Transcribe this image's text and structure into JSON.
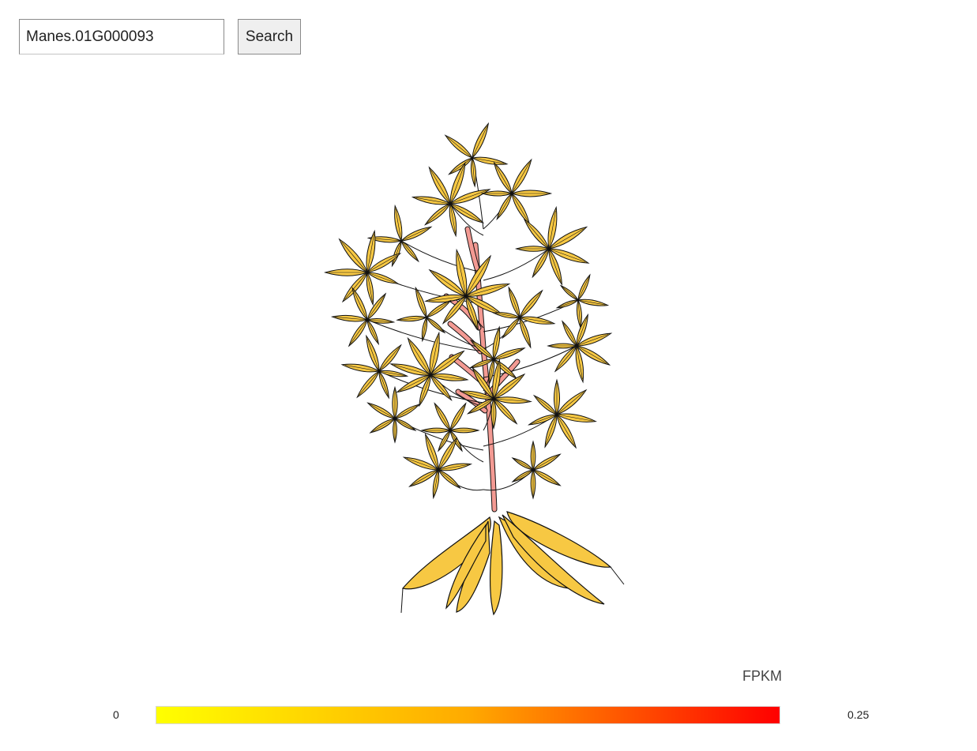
{
  "search": {
    "value": "Manes.01G000093",
    "button_label": "Search"
  },
  "legend": {
    "title": "FPKM",
    "min_label": "0",
    "max_label": "0.25",
    "low_color": "#ffff00",
    "mid_color": "#ffaa00",
    "high_color": "#ff0000"
  },
  "plant": {
    "leaf_color": "#f7c843",
    "stem_color": "#f39a93",
    "root_color": "#f7c843",
    "outline_color": "#111111"
  }
}
